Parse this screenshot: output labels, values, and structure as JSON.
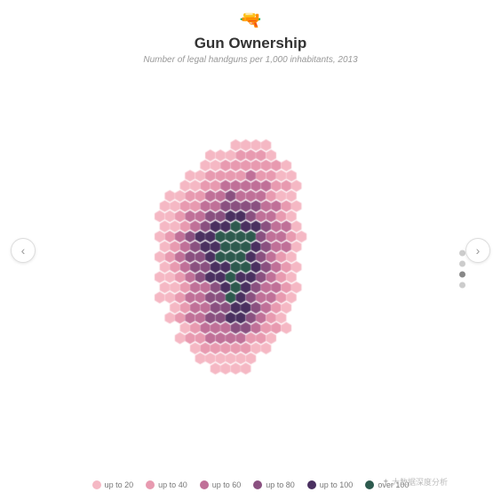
{
  "header": {
    "title": "Gun Ownership",
    "subtitle": "Number of legal handguns per 1,000 inhabitants, 2013",
    "gun_icon": "🔫"
  },
  "navigation": {
    "left_label": "‹",
    "right_label": "›"
  },
  "legend": {
    "items": [
      {
        "label": "up to 20",
        "color": "#f5b8c4"
      },
      {
        "label": "up to 40",
        "color": "#e89ab0"
      },
      {
        "label": "up to 60",
        "color": "#c07098"
      },
      {
        "label": "up to 80",
        "color": "#8a5080"
      },
      {
        "label": "up to 100",
        "color": "#4a3060"
      },
      {
        "label": "over 100",
        "color": "#2d5a4e"
      }
    ]
  },
  "dots": {
    "indicators": [
      {
        "active": false
      },
      {
        "active": false
      },
      {
        "active": true
      },
      {
        "active": false
      }
    ]
  },
  "watermark": {
    "text": "大数据深度分析"
  }
}
